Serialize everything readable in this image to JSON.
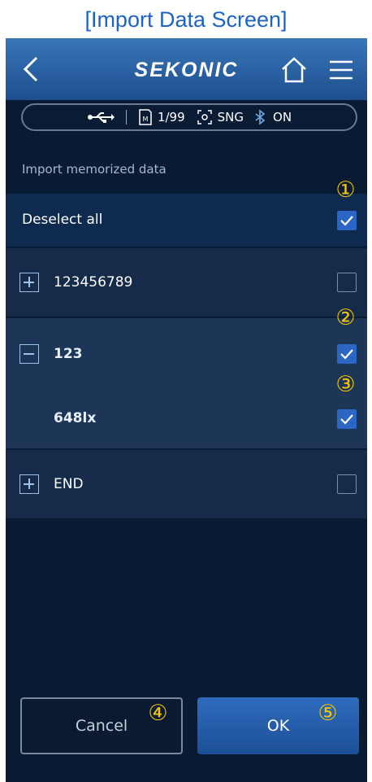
{
  "caption": "[Import Data Screen]",
  "header": {
    "brand": "SEKONIC",
    "back_icon": "chevron-left-icon",
    "home_icon": "home-icon",
    "menu_icon": "hamburger-menu-icon"
  },
  "status": {
    "memory": "1/99",
    "mode": "SNG",
    "bluetooth": "ON",
    "icons": [
      "usb-icon",
      "memory-card-icon",
      "measuring-mode-icon",
      "bluetooth-icon"
    ]
  },
  "section_label": "Import memorized data",
  "deselect": {
    "label": "Deselect all",
    "checked": true
  },
  "items": [
    {
      "label": "123456789",
      "expanded": false,
      "checked": false
    },
    {
      "label": "123",
      "expanded": true,
      "checked": true,
      "children": [
        {
          "label": "648lx",
          "checked": true
        }
      ]
    },
    {
      "label": "END",
      "expanded": false,
      "checked": false
    }
  ],
  "callouts": [
    "①",
    "②",
    "③",
    "④",
    "⑤"
  ],
  "buttons": {
    "cancel": "Cancel",
    "ok": "OK"
  },
  "colors": {
    "accent": "#2c66c4",
    "callout": "#f7c600",
    "background": "#091a33"
  }
}
